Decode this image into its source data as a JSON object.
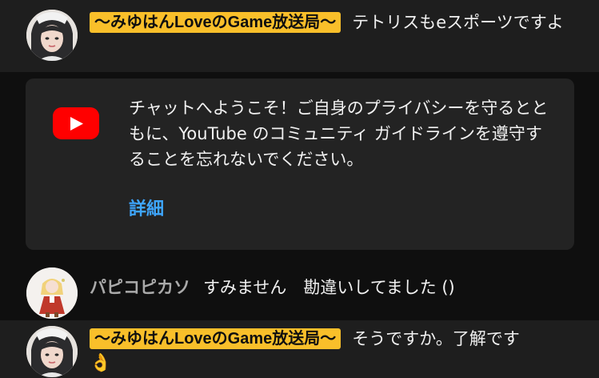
{
  "messages": [
    {
      "author": "〜みゆはんLoveのGame放送局〜",
      "text": "テトリスもeスポーツですよ",
      "author_badge_color": "#f9bf2a"
    },
    {
      "author": "パピコピカソ",
      "text": "すみません　勘違いしてました ()"
    },
    {
      "author": "〜みゆはんLoveのGame放送局〜",
      "text": "そうですか。了解です",
      "emoji": "👌",
      "author_badge_color": "#f9bf2a"
    }
  ],
  "welcome": {
    "icon": "youtube-logo-icon",
    "text": "チャットへようこそ！ご自身のプライバシーを守るとともに、YouTube のコミュニティ ガイドラインを遵守することを忘れないでください。",
    "link_label": "詳細",
    "link_color": "#3ea6ff"
  },
  "colors": {
    "background": "#0f0f0f",
    "highlight_row": "#1e1e1e",
    "card": "#232323",
    "youtube_red": "#ff0000"
  }
}
